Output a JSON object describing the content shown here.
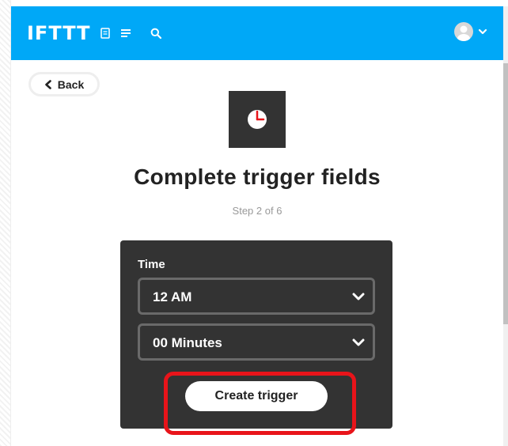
{
  "header": {
    "logo": "IFTTT",
    "icons": [
      "document-icon",
      "list-icon",
      "search-icon"
    ],
    "avatar_icon": "user-avatar-icon",
    "menu_icon": "chevron-down-icon",
    "brand_color": "#00a8f7"
  },
  "back_button": {
    "label": "Back",
    "icon": "chevron-left-icon"
  },
  "service": {
    "icon": "clock-icon",
    "tile_color": "#333333",
    "hand_color": "#e8141a"
  },
  "page": {
    "title": "Complete trigger fields",
    "step": "Step 2 of 6"
  },
  "form": {
    "time_label": "Time",
    "hour_select": {
      "value": "12 AM"
    },
    "minute_select": {
      "value": "00 Minutes"
    },
    "submit_label": "Create trigger"
  },
  "annotation": {
    "highlight_color": "#e8141a"
  }
}
